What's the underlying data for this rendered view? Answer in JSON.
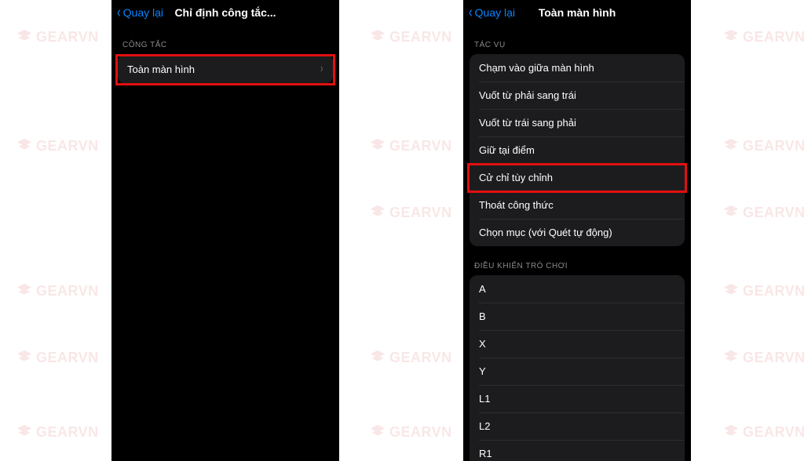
{
  "watermark": "GEARVN",
  "left": {
    "back": "Quay lại",
    "title": "Chỉ định công tắc...",
    "section": "CÔNG TẮC",
    "row": "Toàn màn hình"
  },
  "right": {
    "back": "Quay lại",
    "title": "Toàn màn hình",
    "section1": "TÁC VỤ",
    "tasks": [
      "Chạm vào giữa màn hình",
      "Vuốt từ phải sang trái",
      "Vuốt từ trái sang phải",
      "Giữ tại điểm",
      "Cử chỉ tùy chỉnh",
      "Thoát công thức",
      "Chọn mục (với Quét tự động)"
    ],
    "section2": "ĐIỀU KHIỂN TRÒ CHƠI",
    "gc": [
      "A",
      "B",
      "X",
      "Y",
      "L1",
      "L2",
      "R1"
    ]
  }
}
